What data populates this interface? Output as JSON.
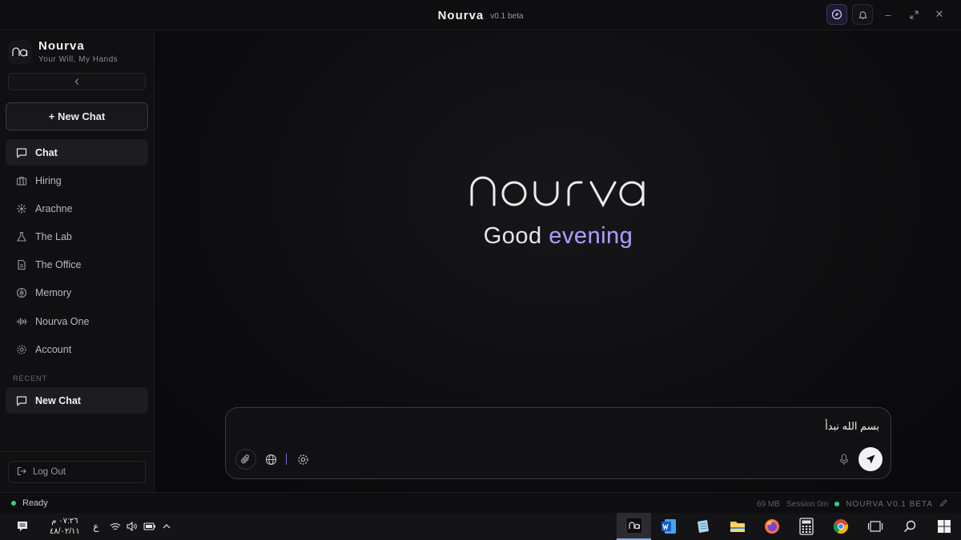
{
  "titlebar": {
    "app_name": "Nourva",
    "version": "v0.1 beta",
    "icons": [
      "compass-icon",
      "bell-icon",
      "minimize-icon",
      "maximize-icon",
      "close-icon"
    ]
  },
  "sidebar": {
    "brand_name": "Nourva",
    "tagline": "Your Will, My Hands",
    "new_chat_label": "+ New Chat",
    "items": [
      {
        "label": "Chat",
        "icon": "chat-icon",
        "active": true
      },
      {
        "label": "Hiring",
        "icon": "briefcase-icon"
      },
      {
        "label": "Arachne",
        "icon": "web-icon"
      },
      {
        "label": "The Lab",
        "icon": "flask-icon"
      },
      {
        "label": "The Office",
        "icon": "document-icon"
      },
      {
        "label": "Memory",
        "icon": "brain-icon"
      },
      {
        "label": "Nourva One",
        "icon": "waveform-icon"
      },
      {
        "label": "Account",
        "icon": "gear-icon"
      }
    ],
    "recent_label": "RECENT",
    "recent_items": [
      {
        "label": "New Chat"
      }
    ],
    "logout_label": "Log Out"
  },
  "main": {
    "logo_text": "nourva",
    "greeting_prefix": "Good ",
    "greeting_highlight": "evening",
    "accent_color": "#a999f5"
  },
  "composer": {
    "value": "بسم الله نبدأ"
  },
  "statusbar": {
    "status": "Ready",
    "memory": "69 MB",
    "session": "Session 0m",
    "product": "NOURVA V0.1 BETA"
  },
  "taskbar": {
    "time": "٠٧:٢٦ م",
    "date": "٤٨/٠٢/١١",
    "lang": "ع",
    "apps": [
      "nourva-app-icon",
      "word-icon",
      "notepad-icon",
      "file-explorer-icon",
      "firefox-icon",
      "calculator-icon",
      "chrome-icon",
      "task-view-icon",
      "search-icon",
      "windows-start-icon"
    ]
  }
}
